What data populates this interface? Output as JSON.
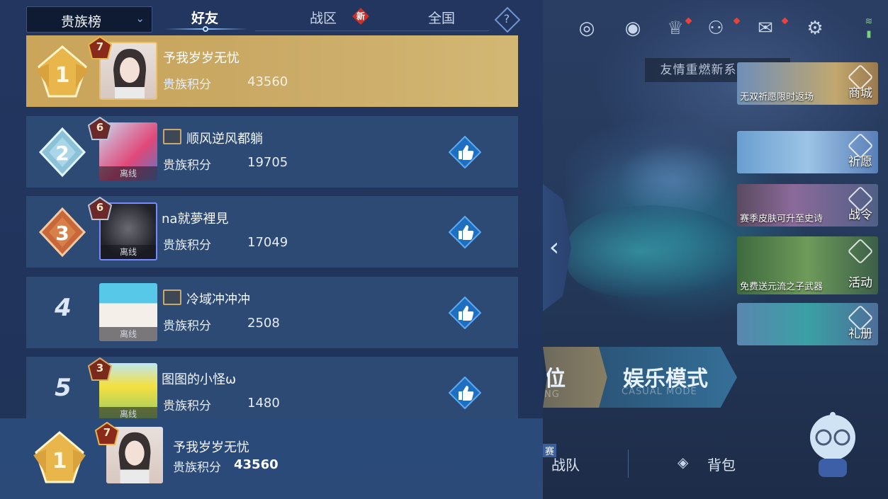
{
  "leaderboard": {
    "rank_type_selected": "贵族榜",
    "tabs": [
      {
        "label": "好友",
        "active": true
      },
      {
        "label": "战区",
        "active": false,
        "badge": "新"
      },
      {
        "label": "全国",
        "active": false
      }
    ],
    "help_label": "?",
    "score_label": "贵族积分",
    "offline_label": "离线",
    "entries": [
      {
        "rank": "1",
        "name": "予我岁岁无忧",
        "score": "43560",
        "level": "7",
        "offline": false,
        "guild": false
      },
      {
        "rank": "2",
        "name": "顺风逆风都躺",
        "score": "19705",
        "level": "6",
        "offline": true,
        "guild": true
      },
      {
        "rank": "3",
        "name": "na就夢裡見",
        "score": "17049",
        "level": "6",
        "offline": true,
        "guild": false
      },
      {
        "rank": "4",
        "name": "冷域冲冲冲",
        "score": "2508",
        "level": "",
        "offline": true,
        "guild": true
      },
      {
        "rank": "5",
        "name": "图图的小怪ω",
        "score": "1480",
        "level": "3",
        "offline": true,
        "guild": false
      }
    ],
    "me": {
      "rank": "1",
      "name": "予我岁岁无忧",
      "score": "43560",
      "level": "7"
    }
  },
  "main": {
    "notice": "友情重燃新系统上线",
    "side_cards": [
      {
        "caption": "无双祈愿限时返场",
        "label": "商城"
      },
      {
        "caption": "",
        "label": "祈愿"
      },
      {
        "caption": "赛季皮肤可升至史诗",
        "label": "战令"
      },
      {
        "caption": "免费送元流之子武器",
        "label": "活动"
      },
      {
        "caption": "",
        "label": "礼册"
      }
    ],
    "mode_left": {
      "title": "位",
      "sub": "NG"
    },
    "mode_right": {
      "title": "娱乐模式",
      "sub": "CASUAL MODE"
    },
    "bottom_nav": {
      "tag": "赛",
      "team": "战队",
      "bag": "背包"
    }
  },
  "colors": {
    "panel_bg": "#223660",
    "row_bg": "#2c4a74",
    "first_row_gold": "#c9a863",
    "red_dot": "#e8433c"
  },
  "icons": [
    "target-icon",
    "eye-icon",
    "trophy-icon",
    "friends-icon",
    "mail-icon",
    "gear-icon",
    "wifi-icon",
    "battery-icon",
    "thumbs-up-icon",
    "chevron-left-icon"
  ]
}
